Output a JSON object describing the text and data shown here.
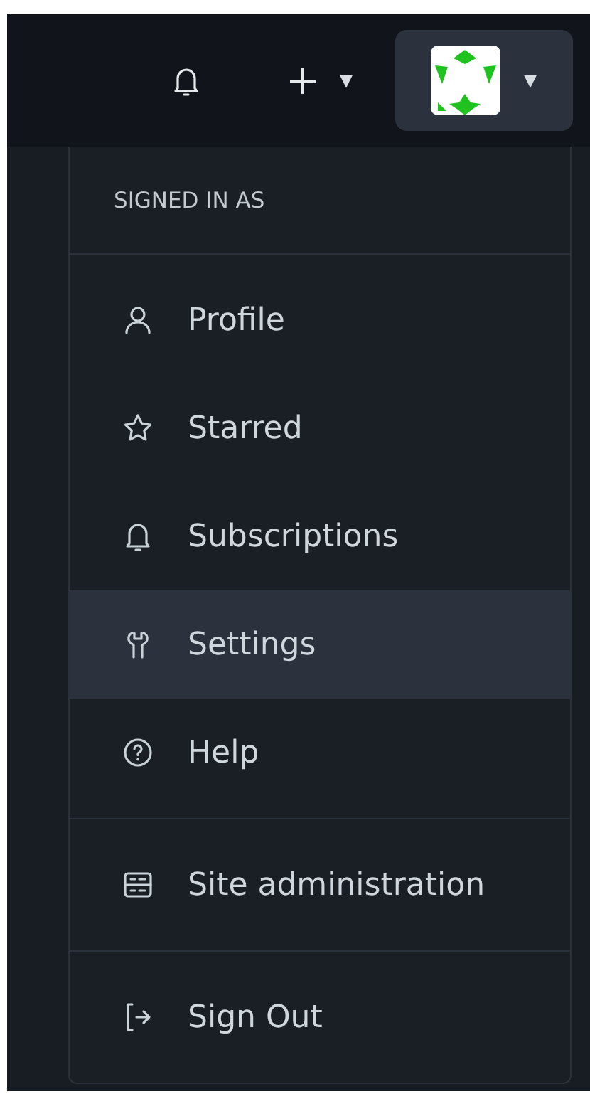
{
  "header": {
    "create_caret": "▾",
    "avatar_caret": "▾",
    "avatar_expanded": true
  },
  "user_menu": {
    "heading": "SIGNED IN AS",
    "sections": [
      {
        "items": [
          {
            "label": "Profile",
            "selected": false
          },
          {
            "label": "Starred",
            "selected": false
          },
          {
            "label": "Subscriptions",
            "selected": false
          },
          {
            "label": "Settings",
            "selected": true
          },
          {
            "label": "Help",
            "selected": false
          }
        ]
      },
      {
        "items": [
          {
            "label": "Site administration",
            "selected": false
          }
        ]
      },
      {
        "items": [
          {
            "label": "Sign Out",
            "selected": false
          }
        ]
      }
    ]
  }
}
